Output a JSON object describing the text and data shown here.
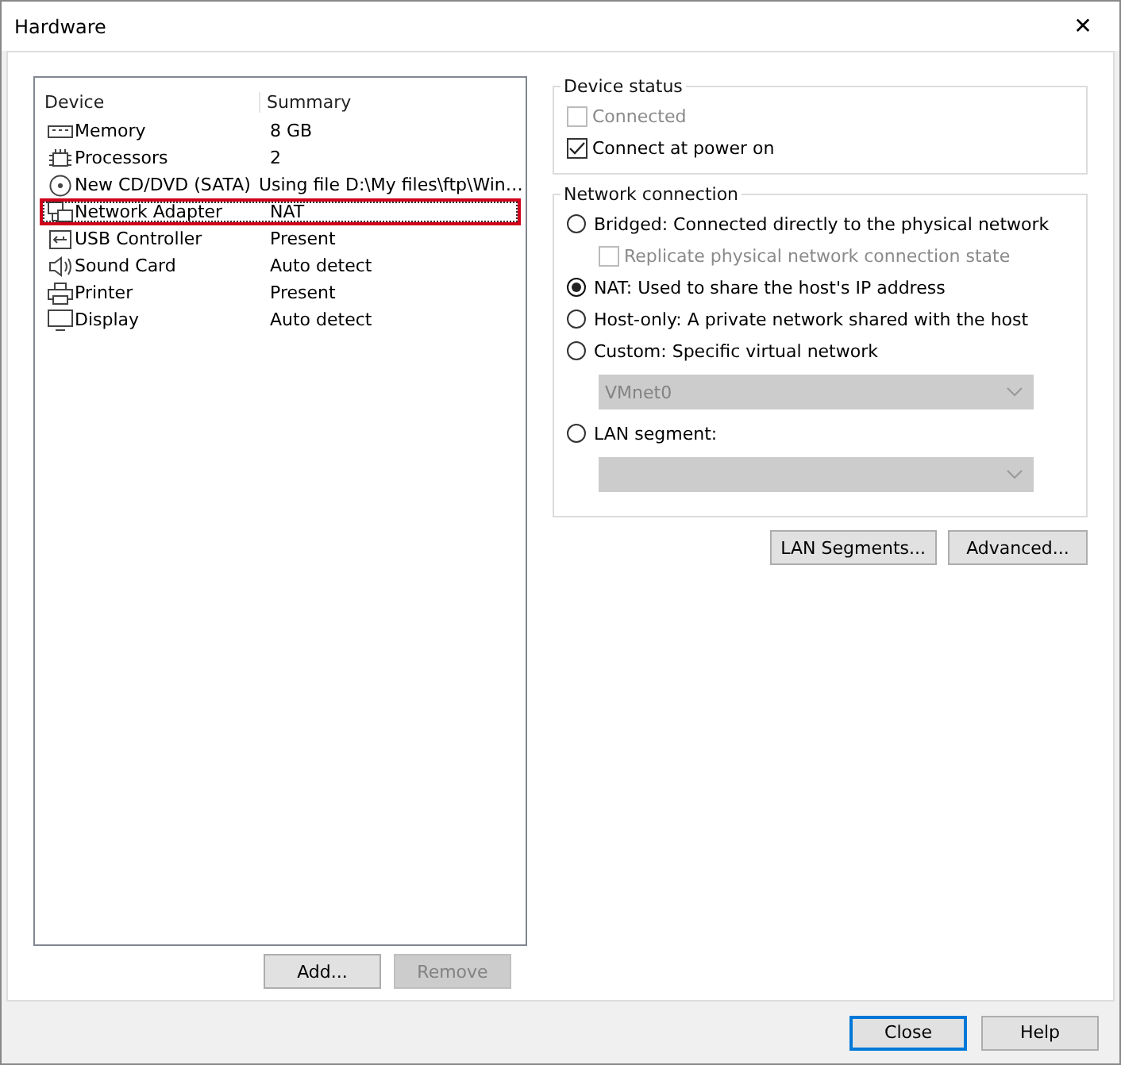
{
  "window": {
    "title": "Hardware",
    "close_glyph": "✕"
  },
  "devices": {
    "columns": [
      "Device",
      "Summary"
    ],
    "rows": [
      {
        "kind": "memory",
        "name": "Memory",
        "summary": "8 GB",
        "selected": false
      },
      {
        "kind": "processor",
        "name": "Processors",
        "summary": "2",
        "selected": false
      },
      {
        "kind": "cd",
        "name": "New CD/DVD (SATA)",
        "summary": "Using file D:\\My files\\ftp\\Win…",
        "selected": false
      },
      {
        "kind": "network",
        "name": "Network Adapter",
        "summary": "NAT",
        "selected": true
      },
      {
        "kind": "usb",
        "name": "USB Controller",
        "summary": "Present",
        "selected": false
      },
      {
        "kind": "sound",
        "name": "Sound Card",
        "summary": "Auto detect",
        "selected": false
      },
      {
        "kind": "printer",
        "name": "Printer",
        "summary": "Present",
        "selected": false
      },
      {
        "kind": "display",
        "name": "Display",
        "summary": "Auto detect",
        "selected": false
      }
    ],
    "buttons": [
      {
        "label": "Add...",
        "disabled": false
      },
      {
        "label": "Remove",
        "disabled": true
      }
    ]
  },
  "device_status": {
    "title": "Device status",
    "options": [
      {
        "label": "Connected",
        "checked": false,
        "disabled": true
      },
      {
        "label": "Connect at power on",
        "checked": true,
        "disabled": false
      }
    ]
  },
  "network_connection": {
    "title": "Network connection",
    "items": [
      {
        "kind": "radio",
        "label": "Bridged: Connected directly to the physical network",
        "selected": false
      },
      {
        "kind": "checkbox",
        "label": "Replicate physical network connection state",
        "checked": false,
        "disabled": true
      },
      {
        "kind": "radio",
        "label": "NAT: Used to share the host's IP address",
        "selected": true
      },
      {
        "kind": "radio",
        "label": "Host-only: A private network shared with the host",
        "selected": false
      },
      {
        "kind": "radio",
        "label": "Custom: Specific virtual network",
        "selected": false
      },
      {
        "kind": "dropdown",
        "value": "VMnet0",
        "disabled": true
      },
      {
        "kind": "radio",
        "label": "LAN segment:",
        "selected": false
      },
      {
        "kind": "dropdown",
        "disabled": true
      }
    ]
  },
  "network_buttons": [
    "LAN Segments...",
    "Advanced..."
  ],
  "footer_buttons": [
    {
      "label": "Close",
      "default": true
    },
    {
      "label": "Help",
      "default": false
    }
  ]
}
